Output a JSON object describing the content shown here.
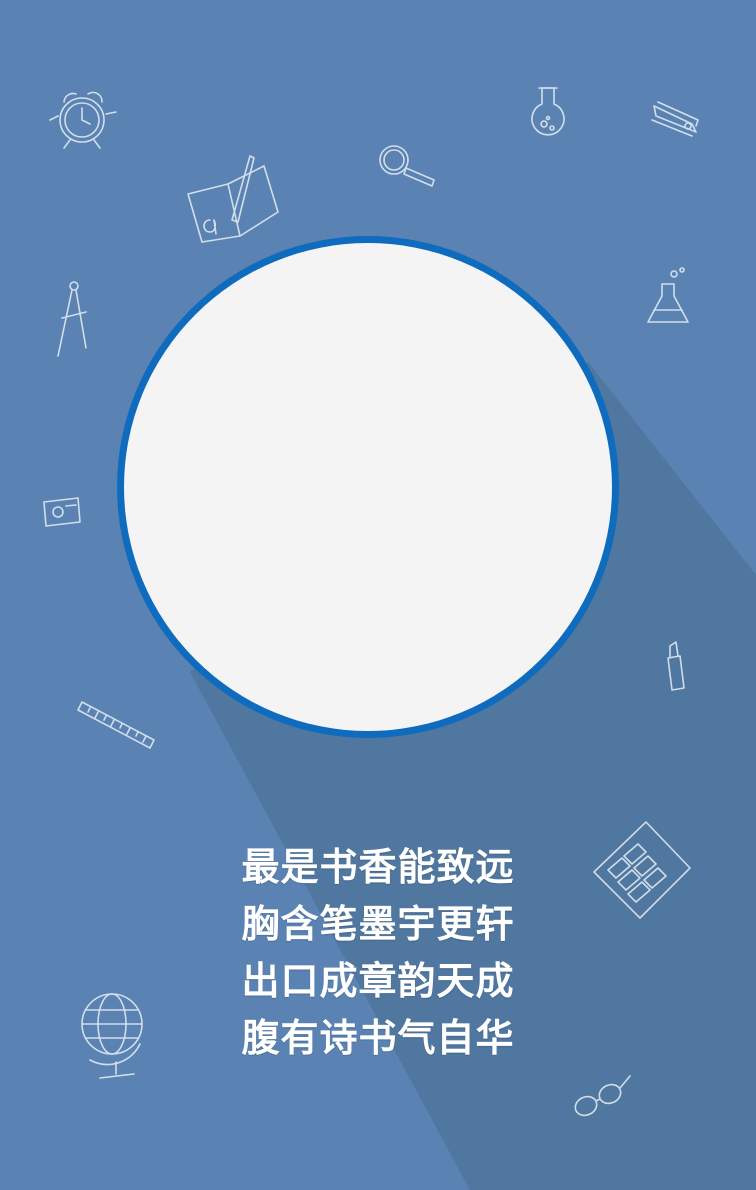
{
  "colors": {
    "background": "#5a82b2",
    "shadow": "#4e7399",
    "circle_ring": "#0f6bbd",
    "circle_fill": "#f4f4f5",
    "text": "#ffffff"
  },
  "poem": {
    "lines": [
      "最是书香能致远",
      "胸含笔墨宇更轩",
      "出口成章韵天成",
      "腹有诗书气自华"
    ]
  },
  "decorations": [
    "alarm-clock-icon",
    "flask-icon",
    "stapler-icon",
    "magnifier-icon",
    "open-book-pen-icon",
    "compass-tool-icon",
    "beaker-icon",
    "sharpener-icon",
    "glue-stick-icon",
    "ruler-icon",
    "calculator-icon",
    "globe-icon",
    "glasses-icon"
  ]
}
